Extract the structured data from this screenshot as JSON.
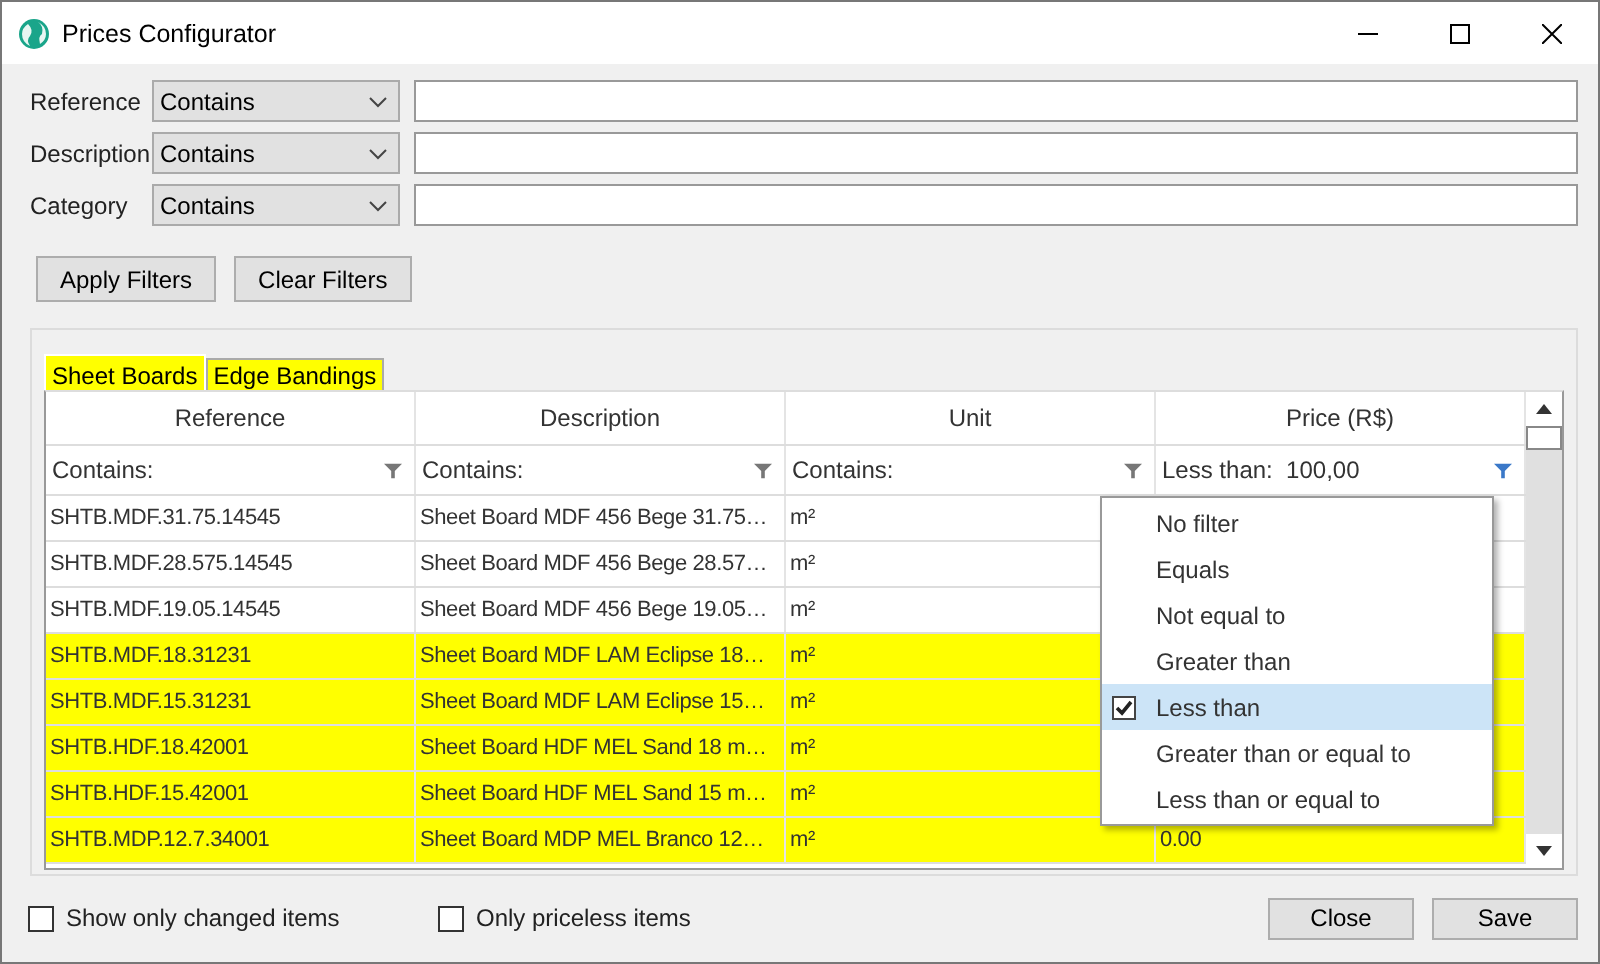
{
  "window": {
    "title": "Prices Configurator"
  },
  "filters": [
    {
      "label": "Reference",
      "operator": "Contains"
    },
    {
      "label": "Description",
      "operator": "Contains"
    },
    {
      "label": "Category",
      "operator": "Contains"
    }
  ],
  "filter_buttons": [
    "Apply Filters",
    "Clear Filters"
  ],
  "tabs": [
    {
      "label": "Sheet Boards",
      "selected": true,
      "highlighted": true
    },
    {
      "label": "Edge Bandings",
      "selected": false,
      "highlighted": true
    }
  ],
  "table": {
    "columns": [
      "Reference",
      "Description",
      "Unit",
      "Price (R$)"
    ],
    "column_filters": [
      {
        "operator": "Contains:",
        "active": false
      },
      {
        "operator": "Contains:",
        "active": false
      },
      {
        "operator": "Contains:",
        "active": false
      },
      {
        "operator": "Less than:",
        "value": "100,00",
        "active": true
      }
    ],
    "rows": [
      {
        "reference": "SHTB.MDF.31.75.14545",
        "description": "Sheet Board MDF 456 Bege 31.75…",
        "unit": "m²",
        "highlighted": false
      },
      {
        "reference": "SHTB.MDF.28.575.14545",
        "description": "Sheet Board MDF 456 Bege 28.57…",
        "unit": "m²",
        "highlighted": false
      },
      {
        "reference": "SHTB.MDF.19.05.14545",
        "description": "Sheet Board MDF 456 Bege 19.05…",
        "unit": "m²",
        "highlighted": false
      },
      {
        "reference": "SHTB.MDF.18.31231",
        "description": "Sheet Board MDF LAM Eclipse 18…",
        "unit": "m²",
        "highlighted": true
      },
      {
        "reference": "SHTB.MDF.15.31231",
        "description": "Sheet Board MDF LAM Eclipse 15…",
        "unit": "m²",
        "highlighted": true
      },
      {
        "reference": "SHTB.HDF.18.42001",
        "description": "Sheet Board HDF MEL Sand 18 m…",
        "unit": "m²",
        "highlighted": true
      },
      {
        "reference": "SHTB.HDF.15.42001",
        "description": "Sheet Board HDF MEL Sand 15 m…",
        "unit": "m²",
        "highlighted": true
      },
      {
        "reference": "SHTB.MDP.12.7.34001",
        "description": "Sheet Board MDP MEL Branco 12…",
        "unit": "m²",
        "price": "0.00",
        "highlighted": true
      }
    ]
  },
  "filter_menu": {
    "items": [
      {
        "label": "No filter",
        "selected": false
      },
      {
        "label": "Equals",
        "selected": false
      },
      {
        "label": "Not equal to",
        "selected": false
      },
      {
        "label": "Greater than",
        "selected": false
      },
      {
        "label": "Less than",
        "selected": true
      },
      {
        "label": "Greater than or equal to",
        "selected": false
      },
      {
        "label": "Less than or equal to",
        "selected": false
      }
    ]
  },
  "options": [
    {
      "label": "Show only changed items",
      "checked": false
    },
    {
      "label": "Only priceless items",
      "checked": false
    }
  ],
  "dialog_buttons": [
    "Close",
    "Save"
  ]
}
